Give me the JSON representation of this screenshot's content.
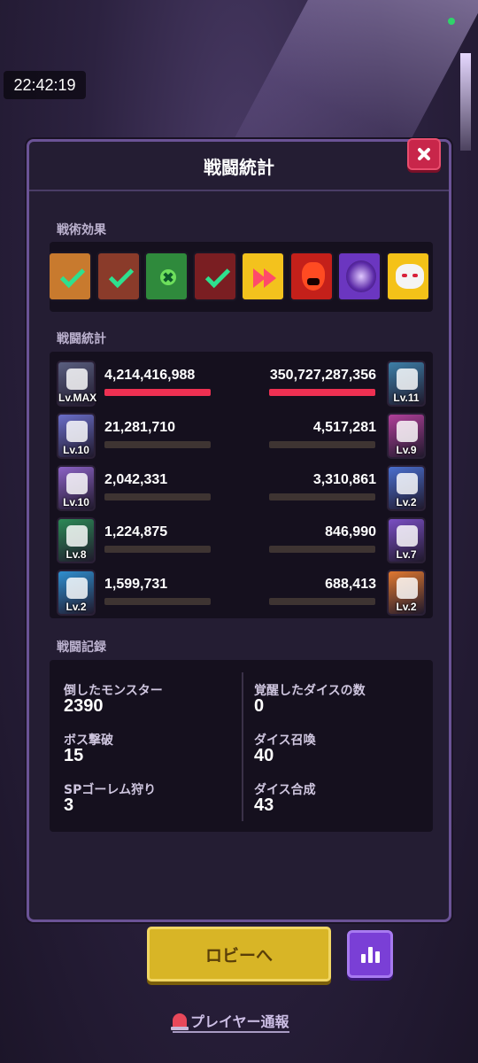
{
  "status": {
    "time": "22:42:19"
  },
  "dialog": {
    "title": "戦闘統計",
    "sections": {
      "effects_label": "戦術効果",
      "stats_label": "戦闘統計",
      "record_label": "戦闘記録"
    },
    "effects": [
      {
        "name": "rotate-check-effect",
        "bg": "#c87a2e",
        "mark": "check"
      },
      {
        "name": "hat-check-effect",
        "bg": "#8a3b2a",
        "mark": "check"
      },
      {
        "name": "wand-cancel-effect",
        "bg": "#2f8a3c",
        "mark": "cross"
      },
      {
        "name": "hat-check-effect-2",
        "bg": "#7a1e22",
        "mark": "check"
      },
      {
        "name": "fast-forward-effect",
        "bg": "#f3c21d",
        "mark": "forward"
      },
      {
        "name": "demon-effect",
        "bg": "#c4201a",
        "mark": "demon"
      },
      {
        "name": "shadow-effect",
        "bg": "#6b36c0",
        "mark": "shadow"
      },
      {
        "name": "cat-effect",
        "bg": "#f4c218",
        "mark": "cat"
      }
    ],
    "stats": {
      "left": [
        {
          "icon": "crystal-dice-icon",
          "level": "Lv.MAX",
          "damage": "4,214,416,988",
          "share": 1.0,
          "color": "#5a5f80"
        },
        {
          "icon": "light-dice-icon",
          "level": "Lv.10",
          "damage": "21,281,710",
          "share": 0.0,
          "color": "#6a6ec9"
        },
        {
          "icon": "flower-dice-icon",
          "level": "Lv.10",
          "damage": "2,042,331",
          "share": 0.0,
          "color": "#8c62c6"
        },
        {
          "icon": "target-dice-icon",
          "level": "Lv.8",
          "damage": "1,224,875",
          "share": 0.0,
          "color": "#2c8a56"
        },
        {
          "icon": "prism-dice-icon",
          "level": "Lv.2",
          "damage": "1,599,731",
          "share": 0.0,
          "color": "#2f8fd0"
        }
      ],
      "right": [
        {
          "icon": "mech-dice-icon",
          "level": "Lv.11",
          "damage": "350,727,287,356",
          "share": 1.0,
          "color": "#3d7fa8"
        },
        {
          "icon": "shield-dice-icon",
          "level": "Lv.9",
          "damage": "4,517,281",
          "share": 0.0,
          "color": "#b0409a"
        },
        {
          "icon": "vortex-dice-icon",
          "level": "Lv.2",
          "damage": "3,310,861",
          "share": 0.0,
          "color": "#4a6fcf"
        },
        {
          "icon": "music-dice-icon",
          "level": "Lv.7",
          "damage": "846,990",
          "share": 0.0,
          "color": "#7a4fc4"
        },
        {
          "icon": "petal-dice-icon",
          "level": "Lv.2",
          "damage": "688,413",
          "share": 0.0,
          "color": "#e07830"
        }
      ]
    },
    "record": {
      "left": [
        {
          "label": "倒したモンスター",
          "value": "2390"
        },
        {
          "label": "ボス撃破",
          "value": "15"
        },
        {
          "label": "SPゴーレム狩り",
          "value": "3"
        }
      ],
      "right": [
        {
          "label": "覚醒したダイスの数",
          "value": "0"
        },
        {
          "label": "ダイス召喚",
          "value": "40"
        },
        {
          "label": "ダイス合成",
          "value": "43"
        }
      ]
    }
  },
  "footer": {
    "lobby_label": "ロビーへ",
    "report_label": "プレイヤー通報"
  }
}
